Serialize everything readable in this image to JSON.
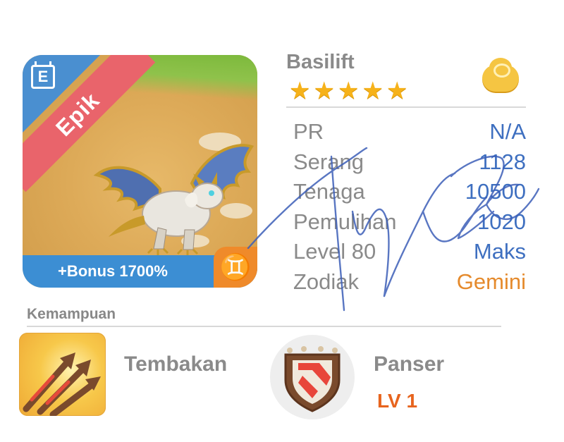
{
  "card": {
    "rarity_label": "Epik",
    "bonus_text": "+Bonus 1700%",
    "zodiac_symbol": "♊",
    "rarity_icon": "calendar-e-icon"
  },
  "monster": {
    "name": "Basilift",
    "stars": 5,
    "element_icon": "cloud-coin-icon"
  },
  "stats": [
    {
      "label": "PR",
      "value": "N/A"
    },
    {
      "label": "Serang",
      "value": "1128"
    },
    {
      "label": "Tenaga",
      "value": "10500"
    },
    {
      "label": "Pemulihan",
      "value": "1020"
    },
    {
      "label": "Level 80",
      "value": "Maks"
    },
    {
      "label": "Zodiak",
      "value": "Gemini"
    }
  ],
  "abilities": {
    "section_title": "Kemampuan",
    "items": [
      {
        "name": "Tembakan",
        "icon": "arrows-icon"
      },
      {
        "name": "Panser",
        "icon": "shield-icon",
        "level": "LV 1"
      }
    ]
  },
  "colors": {
    "value_blue": "#3e6fc0",
    "zodiac_orange": "#e58a2c",
    "level_orange": "#e7641e",
    "rarity_red": "#e9646b",
    "bonus_blue": "#3c8ed3"
  }
}
